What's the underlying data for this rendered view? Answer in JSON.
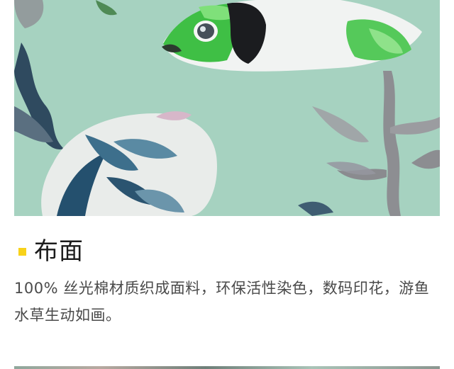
{
  "fabric_section": {
    "title": "布面",
    "description": "100% 丝光棉材质织成面料，环保活性染色，数码印花，游鱼水草生动如画。",
    "marker_color": "#f8d21a"
  },
  "photo": {
    "background_color": "#a9d5c3"
  }
}
